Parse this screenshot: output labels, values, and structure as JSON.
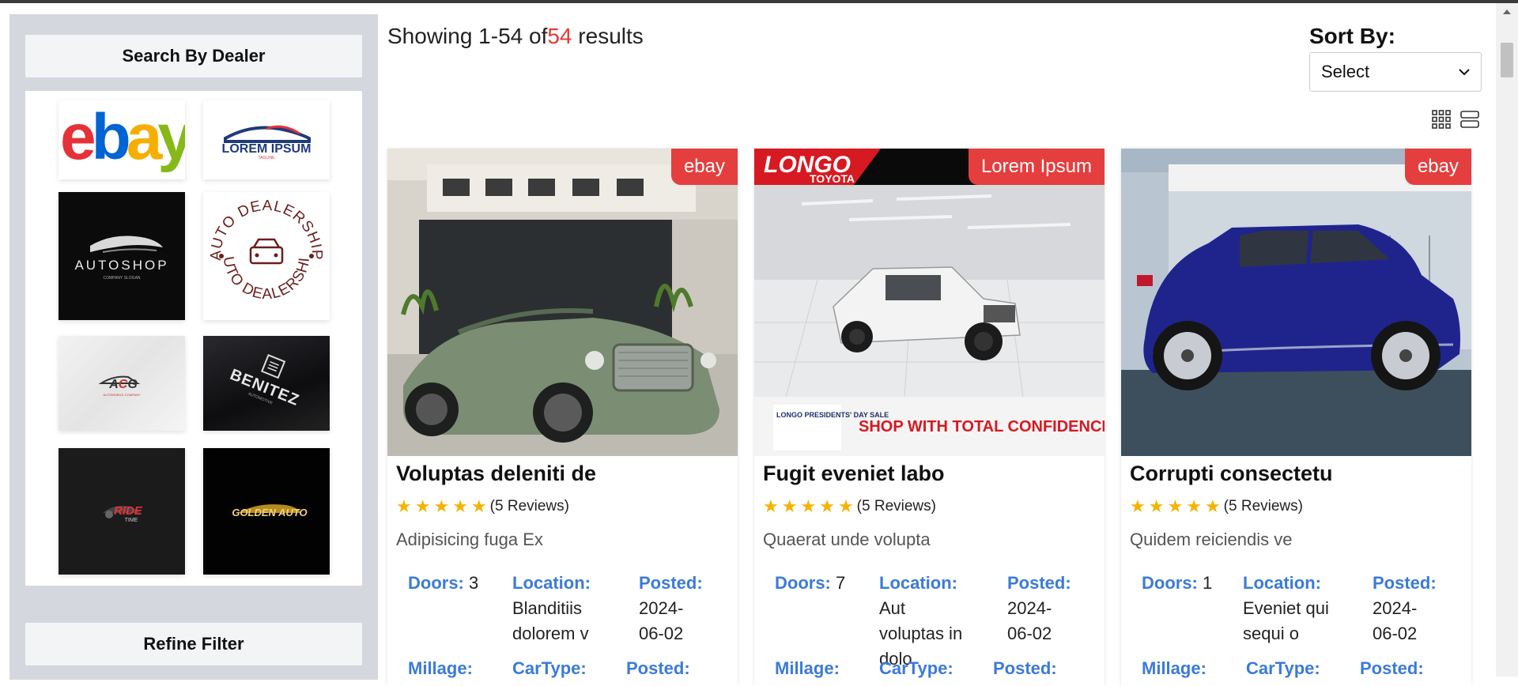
{
  "sidebar": {
    "dealer_heading": "Search By Dealer",
    "filter_heading": "Refine Filter",
    "dealers": [
      {
        "name": "ebay",
        "logo_text": "ebay"
      },
      {
        "name": "lorem-ipsum",
        "logo_text": "LOREM IPSUM"
      },
      {
        "name": "autoshop",
        "logo_text": "AUTOSHOP"
      },
      {
        "name": "auto-dealership",
        "logo_text": "AUTO DEALERSHIP"
      },
      {
        "name": "acg",
        "logo_text": "ACG"
      },
      {
        "name": "benitez",
        "logo_text": "BENITEZ"
      },
      {
        "name": "ride-time",
        "logo_text": "RIDE TIME"
      },
      {
        "name": "golden-auto",
        "logo_text": "GOLDEN AUTO"
      }
    ]
  },
  "results": {
    "prefix": "Showing 1-54 of",
    "total": "54",
    "suffix": " results"
  },
  "sort": {
    "label": "Sort By:",
    "selected": "Select"
  },
  "cards": [
    {
      "badge": "ebay",
      "title": "Voluptas deleniti de",
      "reviews": "(5 Reviews)",
      "rating": 5,
      "desc": "Adipisicing fuga Ex",
      "doors_label": "Doors:",
      "doors": "3",
      "location_label": "Location:",
      "location_l1": "Blanditiis",
      "location_l2": "dolorem v",
      "location_l3": "",
      "posted_label": "Posted:",
      "posted_l1": "2024-",
      "posted_l2": "06-02",
      "millage_label": "Millage:",
      "cartype_label": "CarType:",
      "posted2_label": "Posted:"
    },
    {
      "badge": "Lorem Ipsum",
      "title": "Fugit eveniet labo",
      "reviews": "(5 Reviews)",
      "rating": 5,
      "desc": "Quaerat unde volupta",
      "doors_label": "Doors:",
      "doors": "7",
      "location_label": "Location:",
      "location_l1": "Aut",
      "location_l2": "voluptas in",
      "location_l3": "dolo",
      "posted_label": "Posted:",
      "posted_l1": "2024-",
      "posted_l2": "06-02",
      "millage_label": "Millage:",
      "cartype_label": "CarType:",
      "posted2_label": "Posted:",
      "banner_brand": "LONGO",
      "banner_sub": "TOYOTA",
      "banner_promo": "LONGO PRESIDENTS' DAY SALE",
      "banner_tagline": "SHOP WITH TOTAL CONFIDENCE"
    },
    {
      "badge": "ebay",
      "title": "Corrupti consectetu",
      "reviews": "(5 Reviews)",
      "rating": 5,
      "desc": "Quidem reiciendis ve",
      "doors_label": "Doors:",
      "doors": "1",
      "location_label": "Location:",
      "location_l1": "Eveniet qui",
      "location_l2": "sequi o",
      "location_l3": "",
      "posted_label": "Posted:",
      "posted_l1": "2024-",
      "posted_l2": "06-02",
      "millage_label": "Millage:",
      "cartype_label": "CarType:",
      "posted2_label": "Posted:"
    }
  ],
  "colors": {
    "accent_red": "#e53e3e",
    "link_blue": "#3b7bd8",
    "star": "#f5b301",
    "sidebar_bg": "#d4d7de"
  }
}
